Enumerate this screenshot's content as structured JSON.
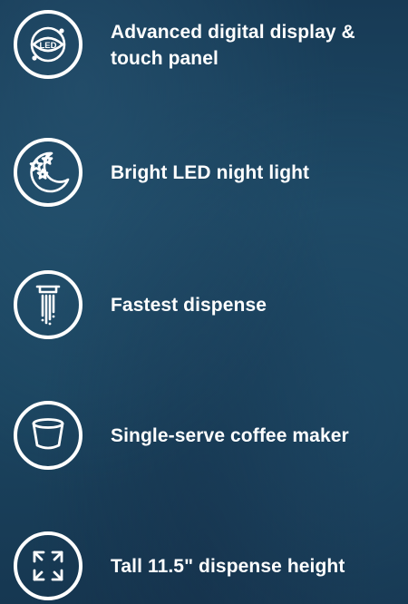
{
  "features": [
    {
      "icon": "led-display-icon",
      "label": "Advanced digital display & touch panel",
      "icon_text": "LED"
    },
    {
      "icon": "moon-stars-icon",
      "label": "Bright LED night light"
    },
    {
      "icon": "dispense-stream-icon",
      "label": "Fastest dispense"
    },
    {
      "icon": "coffee-pod-icon",
      "label": "Single-serve coffee maker"
    },
    {
      "icon": "expand-arrows-icon",
      "label": "Tall 11.5\" dispense height"
    }
  ],
  "colors": {
    "background": "#1e4a66",
    "foreground": "#ffffff"
  }
}
